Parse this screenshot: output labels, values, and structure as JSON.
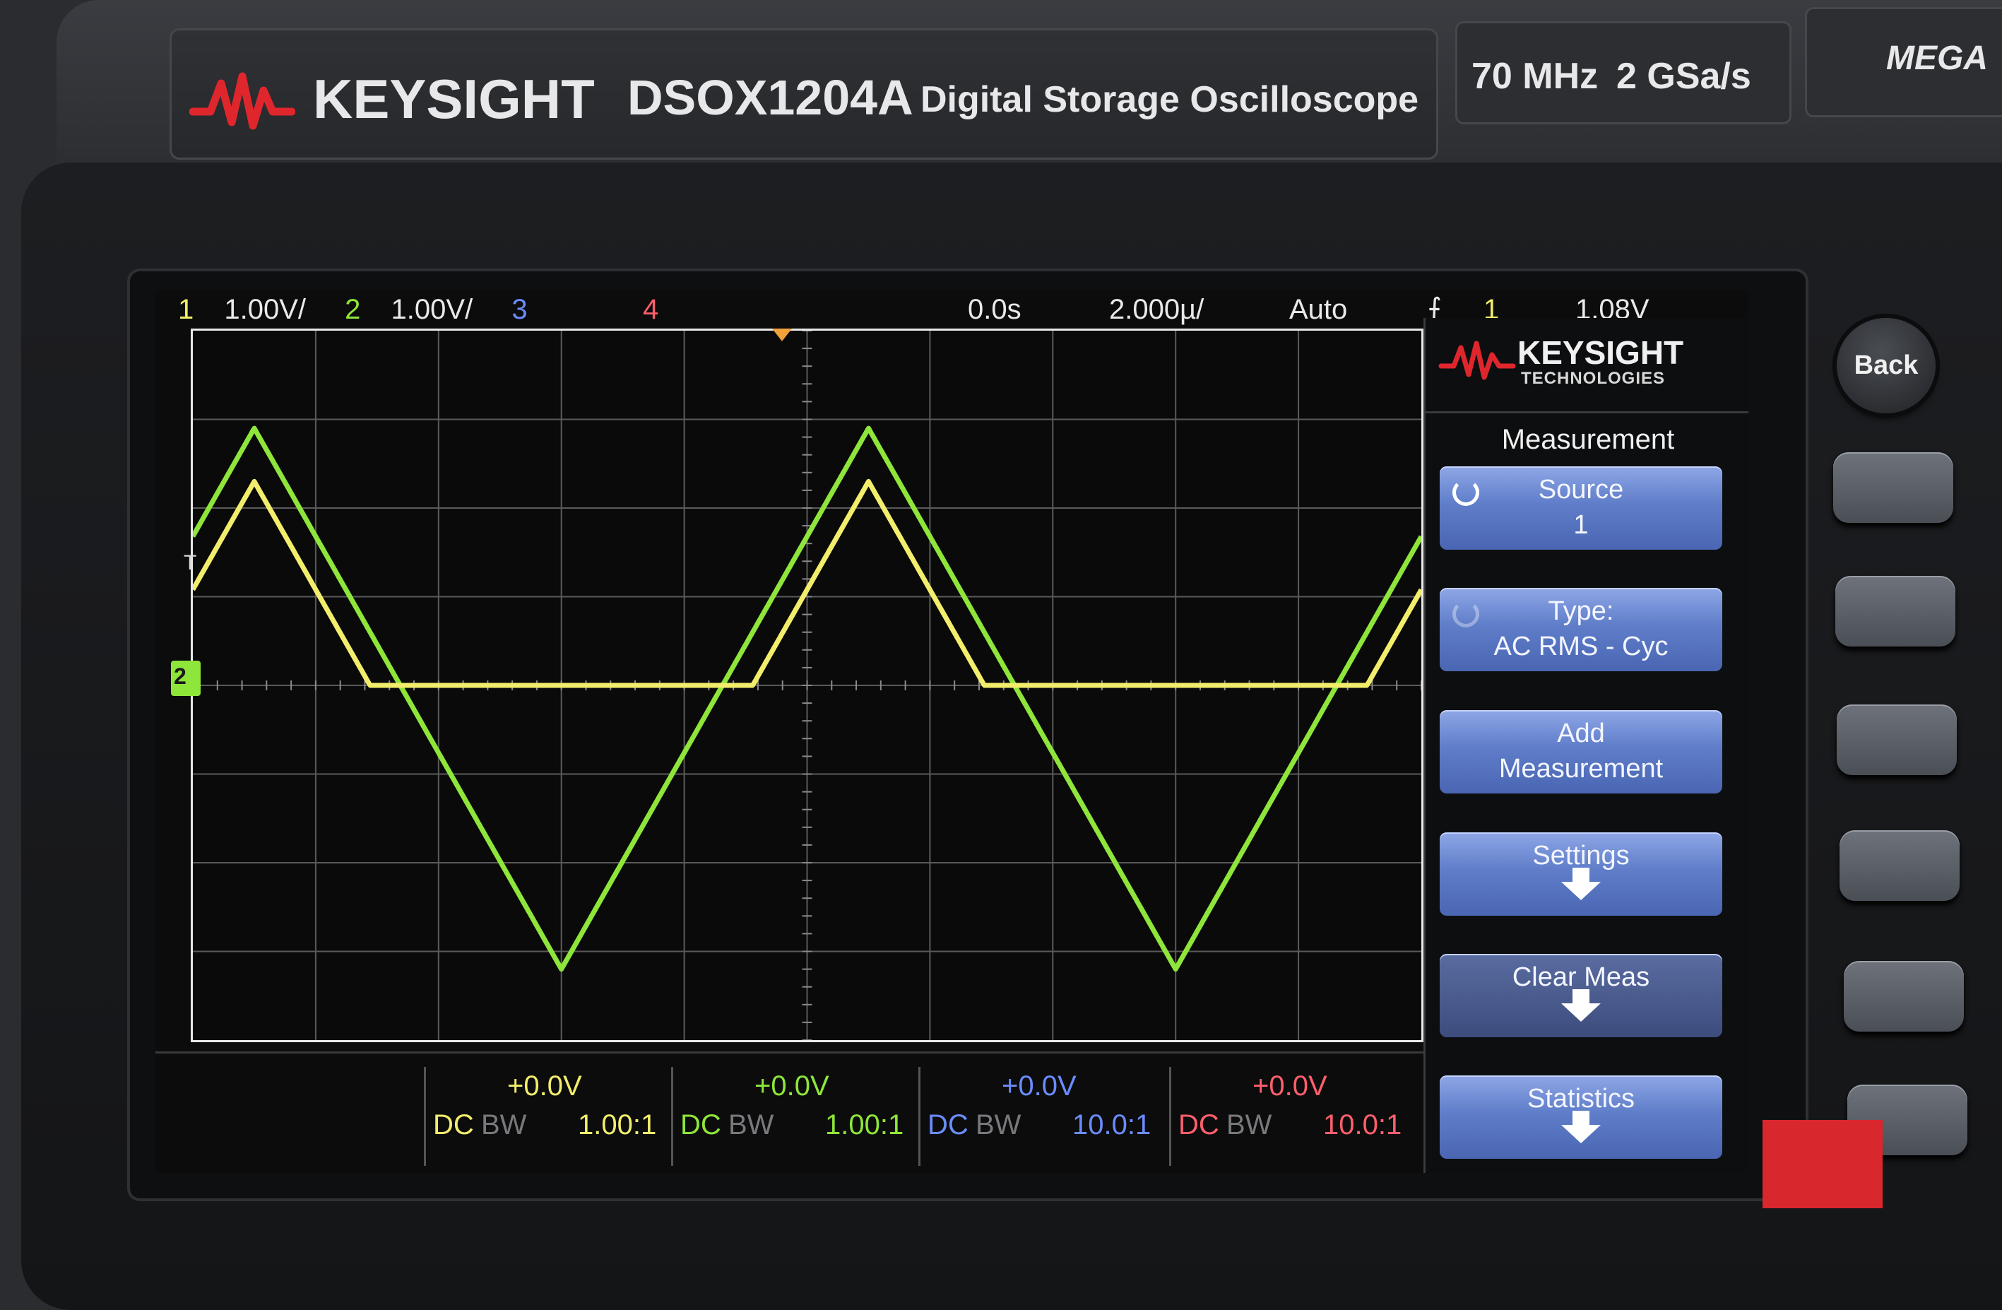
{
  "instrument": {
    "brand": "KEYSIGHT",
    "model": "DSOX1204A",
    "description": "Digital Storage Oscilloscope",
    "bandwidth": "70 MHz",
    "sample_rate": "2 GSa/s",
    "badge": "MEGA"
  },
  "status_bar": {
    "ch1_num": "1",
    "ch1_scale": "1.00V/",
    "ch2_num": "2",
    "ch2_scale": "1.00V/",
    "ch3_num": "3",
    "ch4_num": "4",
    "delay": "0.0s",
    "timebase": "2.000µ/",
    "trigger_mode": "Auto",
    "trigger_slope": "⨍",
    "trigger_source": "1",
    "trigger_level": "1.08V"
  },
  "markers": {
    "trigger_marker": "T",
    "ground_marker": "2"
  },
  "menu": {
    "logo_line1": "KEYSIGHT",
    "logo_line2": "TECHNOLOGIES",
    "title": "Measurement",
    "softkeys": [
      {
        "line1": "Source",
        "line2": "1"
      },
      {
        "line1": "Type:",
        "line2": "AC RMS - Cyc"
      },
      {
        "line1": "Add",
        "line2": "Measurement"
      },
      {
        "line1": "Settings",
        "line2": ""
      },
      {
        "line1": "Clear Meas",
        "line2": ""
      },
      {
        "line1": "Statistics",
        "line2": ""
      }
    ]
  },
  "channels": [
    {
      "offset": "+0.0V",
      "coupling": "DC",
      "bw": "BW",
      "probe": "1.00:1"
    },
    {
      "offset": "+0.0V",
      "coupling": "DC",
      "bw": "BW",
      "probe": "1.00:1"
    },
    {
      "offset": "+0.0V",
      "coupling": "DC",
      "bw": "BW",
      "probe": "10.0:1"
    },
    {
      "offset": "+0.0V",
      "coupling": "DC",
      "bw": "BW",
      "probe": "10.0:1"
    }
  ],
  "hardware": {
    "back_label": "Back"
  },
  "colors": {
    "ch1": "#f2ee6c",
    "ch2": "#8ee63a",
    "ch3": "#6b8cff",
    "ch4": "#ff5f6c",
    "softkey": "#5f7dc9",
    "grid": "#5a5a5a"
  },
  "waveforms": {
    "volts_per_div": 1.0,
    "seconds_per_div": 2e-06,
    "center_time": 0.0,
    "ch2_triangle": {
      "peak_v": 2.9,
      "trough_v": -3.2,
      "period_s": 1e-05,
      "first_peak_s": -9e-06
    },
    "ch1_clipped_triangle": {
      "peak_v": 2.3,
      "floor_v": 0.0,
      "period_s": 1e-05,
      "first_peak_s": -9e-06
    }
  }
}
